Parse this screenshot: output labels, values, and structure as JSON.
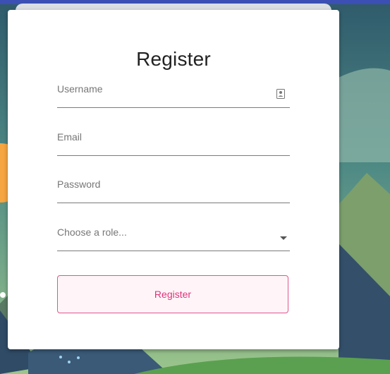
{
  "title": "Register",
  "fields": {
    "username": {
      "placeholder": "Username",
      "icon": "contact-card-icon"
    },
    "email": {
      "placeholder": "Email"
    },
    "password": {
      "placeholder": "Password"
    },
    "role": {
      "placeholder": "Choose a role...",
      "icon": "dropdown-arrow-icon"
    }
  },
  "button": {
    "label": "Register"
  },
  "colors": {
    "accent": "#e0327a",
    "topbar": "#3b4fb4",
    "card": "#ffffff"
  }
}
